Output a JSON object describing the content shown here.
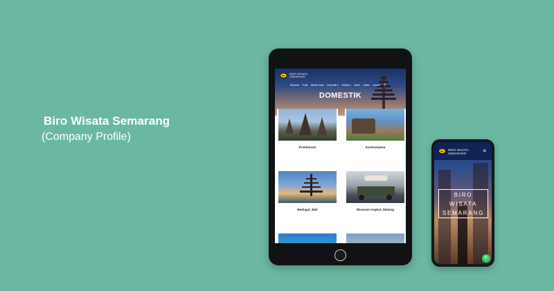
{
  "caption": {
    "title": "Biro Wisata Semarang",
    "subtitle": "(Company Profile)"
  },
  "tablet": {
    "logo_text": "Bie",
    "brand_line1": "BIRO WISATA",
    "brand_line2": "SEMARANG",
    "nav": [
      "Beranda",
      "Profil",
      "Wisata Halal",
      "Domestik",
      "Wisata",
      "Galeri",
      "Artikel",
      "Kontak"
    ],
    "heading": "DOMESTIK",
    "cards": [
      {
        "label": "Prambanan",
        "image": "prambanan"
      },
      {
        "label": "Karimunjawa",
        "image": "karimunjawa"
      },
      {
        "label": "Bedugul, Bali",
        "image": "bali"
      },
      {
        "label": "Museum Angkut, Malang",
        "image": "museum"
      },
      {
        "label": "",
        "image": "coast"
      },
      {
        "label": "",
        "image": "mosque"
      }
    ]
  },
  "phone": {
    "logo_text": "Bie",
    "brand_line1": "BIRO WISATA",
    "brand_line2": "SEMARANG",
    "hero_line1": "BIRO",
    "hero_line2": "WISATA",
    "hero_line3": "SEMARANG"
  },
  "colors": {
    "background": "#6bb8a2",
    "device": "#111214",
    "logo_yellow": "#f2c400",
    "whatsapp": "#25d366"
  },
  "icons": [
    "search-icon",
    "hamburger-menu-icon",
    "whatsapp-icon",
    "chevron-down-icon"
  ]
}
